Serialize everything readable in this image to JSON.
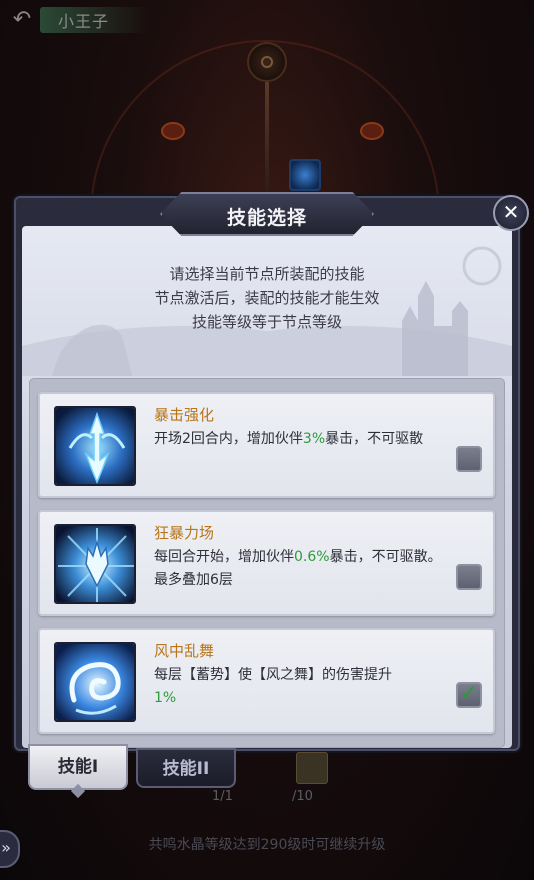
{
  "header": {
    "title": "小王子",
    "back_icon": "back-arrow-icon"
  },
  "dialog": {
    "title": "技能选择",
    "close_icon": "close-x-icon",
    "intro": [
      "请选择当前节点所装配的技能",
      "节点激活后，装配的技能才能生效",
      "技能等级等于节点等级"
    ]
  },
  "skills": [
    {
      "name": "暴击强化",
      "desc_before": "开场2回合内，增加伙伴",
      "highlight": "3%",
      "desc_after": "暴击，不可驱散",
      "icon": "trident-blade-icon",
      "checked": false
    },
    {
      "name": "狂暴力场",
      "desc_before": "每回合开始，增加伙伴",
      "highlight": "0.6%",
      "desc_after": "暴击，不可驱散。最多叠加6层",
      "icon": "trident-burst-icon",
      "checked": false
    },
    {
      "name": "风中乱舞",
      "desc_before": "每层【蓄势】使【风之舞】的伤害提升",
      "highlight": "1%",
      "desc_after": "",
      "icon": "wind-swirl-icon",
      "checked": true
    }
  ],
  "tabs": [
    {
      "label": "技能I",
      "active": true
    },
    {
      "label": "技能II",
      "active": false
    }
  ],
  "counts": {
    "first": "1/1",
    "second": "/10"
  },
  "footer": "共鸣水晶等级达到290级时可继续升级",
  "colors": {
    "skill_name": "#b8751a",
    "highlight": "#2e9a3a",
    "panel": "#e6e9f3"
  }
}
